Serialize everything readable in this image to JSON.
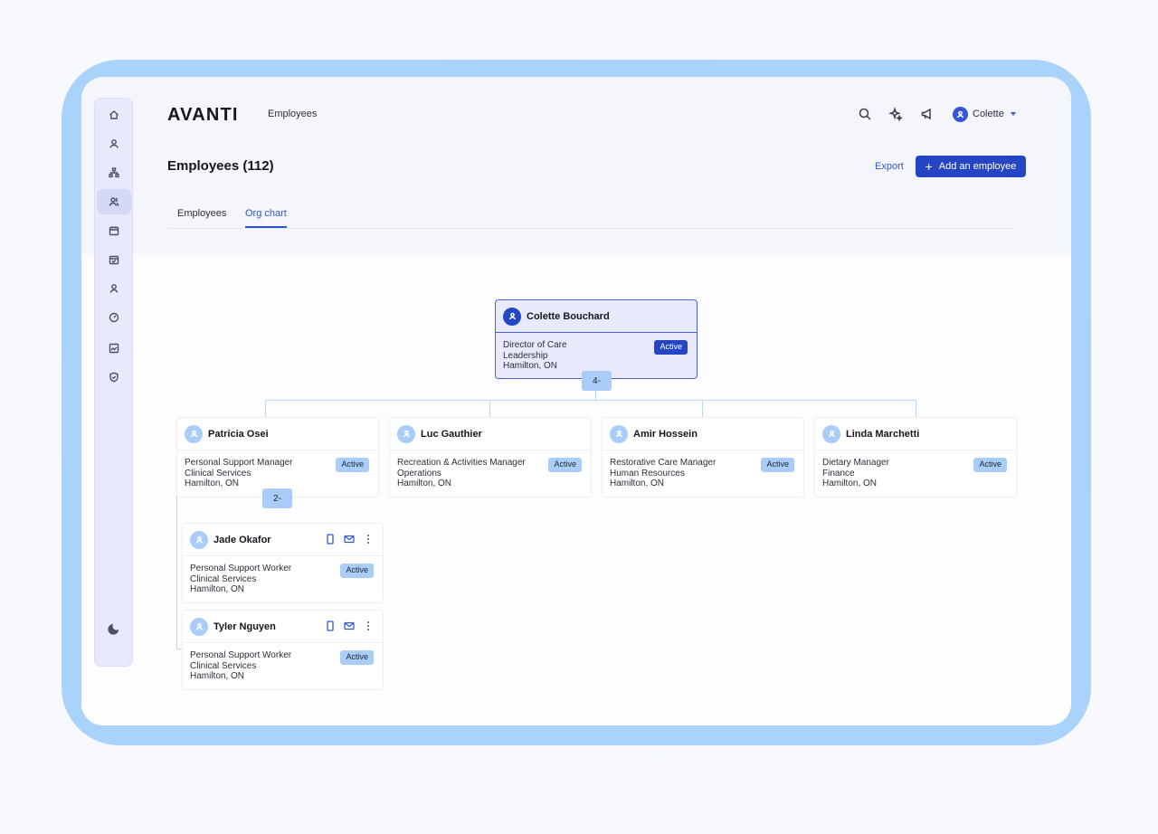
{
  "app": {
    "logo": "AVANTI",
    "breadcrumb": "Employees"
  },
  "user": {
    "name": "Colette"
  },
  "header": {
    "title": "Employees (112)",
    "export_label": "Export",
    "add_label": "Add an employee"
  },
  "tabs": [
    {
      "label": "Employees",
      "active": false
    },
    {
      "label": "Org chart",
      "active": true
    }
  ],
  "sidebar": {
    "items": [
      {
        "icon": "home-icon"
      },
      {
        "icon": "user-icon"
      },
      {
        "icon": "org-chart-icon"
      },
      {
        "icon": "people-icon",
        "active": true
      },
      {
        "icon": "calendar-icon"
      },
      {
        "icon": "schedule-icon"
      },
      {
        "icon": "person-icon"
      },
      {
        "icon": "gauge-icon"
      },
      {
        "icon": "analytics-icon"
      },
      {
        "icon": "shield-icon"
      }
    ],
    "theme_icon": "moon-icon"
  },
  "org": {
    "root": {
      "name": "Colette Bouchard",
      "title": "Director of Care",
      "department": "Leadership",
      "location": "Hamilton, ON",
      "status": "Active",
      "reports_count": "4-"
    },
    "managers": [
      {
        "name": "Patricia Osei",
        "title": "Personal Support Manager",
        "department": "Clinical Services",
        "location": "Hamilton, ON",
        "status": "Active",
        "reports_count": "2-"
      },
      {
        "name": "Luc Gauthier",
        "title": "Recreation & Activities Manager",
        "department": "Operations",
        "location": "Hamilton, ON",
        "status": "Active"
      },
      {
        "name": "Amir Hossein",
        "title": "Restorative Care Manager",
        "department": "Human Resources",
        "location": "Hamilton, ON",
        "status": "Active"
      },
      {
        "name": "Linda Marchetti",
        "title": "Dietary Manager",
        "department": "Finance",
        "location": "Hamilton, ON",
        "status": "Active"
      }
    ],
    "reports": [
      {
        "name": "Jade Okafor",
        "title": "Personal Support Worker",
        "department": "Clinical Services",
        "location": "Hamilton, ON",
        "status": "Active"
      },
      {
        "name": "Tyler Nguyen",
        "title": "Personal Support Worker",
        "department": "Clinical Services",
        "location": "Hamilton, ON",
        "status": "Active"
      }
    ]
  },
  "colors": {
    "frame": "#a9d3fb",
    "primary": "#2446c4",
    "badge": "#a9cdf8"
  }
}
